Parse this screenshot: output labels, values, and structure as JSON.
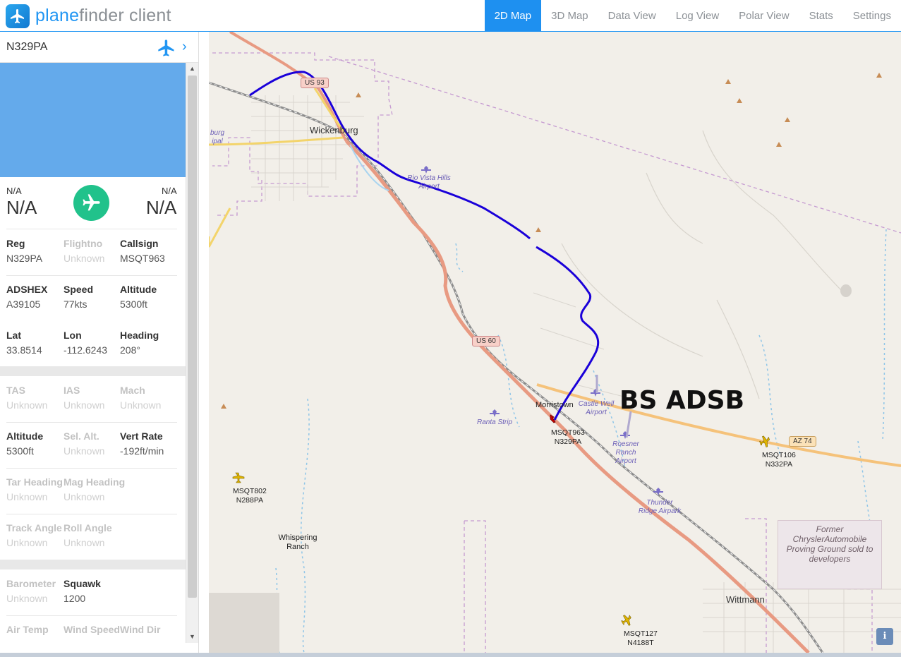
{
  "app": {
    "brand_part1": "plane",
    "brand_part2": "finder client"
  },
  "nav": {
    "tabs": [
      {
        "label": "2D Map",
        "active": true
      },
      {
        "label": "3D Map",
        "active": false
      },
      {
        "label": "Data View",
        "active": false
      },
      {
        "label": "Log View",
        "active": false
      },
      {
        "label": "Polar View",
        "active": false
      },
      {
        "label": "Stats",
        "active": false
      },
      {
        "label": "Settings",
        "active": false
      }
    ]
  },
  "sidebar": {
    "flight_id": "N329PA",
    "route": {
      "origin_code": "N/A",
      "origin_name": "N/A",
      "dest_code": "N/A",
      "dest_name": "N/A"
    },
    "fields": {
      "reg": {
        "label": "Reg",
        "value": "N329PA"
      },
      "flightno": {
        "label": "Flightno",
        "value": "Unknown"
      },
      "callsign": {
        "label": "Callsign",
        "value": "MSQT963"
      },
      "adshex": {
        "label": "ADSHEX",
        "value": "A39105"
      },
      "speed": {
        "label": "Speed",
        "value": "77kts"
      },
      "altitude": {
        "label": "Altitude",
        "value": "5300ft"
      },
      "lat": {
        "label": "Lat",
        "value": "33.8514"
      },
      "lon": {
        "label": "Lon",
        "value": "-112.6243"
      },
      "heading": {
        "label": "Heading",
        "value": "208°"
      },
      "tas": {
        "label": "TAS",
        "value": "Unknown"
      },
      "ias": {
        "label": "IAS",
        "value": "Unknown"
      },
      "mach": {
        "label": "Mach",
        "value": "Unknown"
      },
      "altitude2": {
        "label": "Altitude",
        "value": "5300ft"
      },
      "sel_alt": {
        "label": "Sel. Alt.",
        "value": "Unknown"
      },
      "vert_rate": {
        "label": "Vert Rate",
        "value": "-192ft/min"
      },
      "tar_heading": {
        "label": "Tar Heading",
        "value": "Unknown"
      },
      "mag_heading": {
        "label": "Mag Heading",
        "value": "Unknown"
      },
      "track_angle": {
        "label": "Track Angle",
        "value": "Unknown"
      },
      "roll_angle": {
        "label": "Roll Angle",
        "value": "Unknown"
      },
      "barometer": {
        "label": "Barometer",
        "value": "Unknown"
      },
      "squawk": {
        "label": "Squawk",
        "value": "1200"
      },
      "air_temp": {
        "label": "Air Temp",
        "value": ""
      },
      "wind_speed": {
        "label": "Wind Speed",
        "value": ""
      },
      "wind_dir": {
        "label": "Wind Dir",
        "value": ""
      }
    }
  },
  "map": {
    "overlay_text": "BS ADSB",
    "towns": {
      "wickenburg": "Wickenburg",
      "morristown": "Morristown",
      "wittmann": "Wittmann",
      "whispering_ranch": "Whispering Ranch"
    },
    "airports": {
      "rio_vista": "Rio Vista Hills Airport",
      "castle_well": "Castle Well Airport",
      "ranta": "Ranta Strip",
      "roesner": "Roesner Ranch Airport",
      "thunder_ridge": "Thunder Ridge Airpark",
      "wickenburg_partial": "burg ipal"
    },
    "shields": {
      "us93": "US 93",
      "us60": "US 60",
      "az74": "AZ 74"
    },
    "proving_ground": "Former ChryslerAutomobile Proving Ground sold to developers",
    "aircraft": [
      {
        "callsign": "MSQT963",
        "reg": "N329PA"
      },
      {
        "callsign": "MSQT106",
        "reg": "N332PA"
      },
      {
        "callsign": "MSQT802",
        "reg": "N288PA"
      },
      {
        "callsign": "MSQT127",
        "reg": "N4188T"
      }
    ],
    "info_button": "i",
    "colors": {
      "track": "#1a00d9",
      "highway": "#f0a18a",
      "state_road": "#f5c27a",
      "accent": "#1e90f0"
    }
  }
}
